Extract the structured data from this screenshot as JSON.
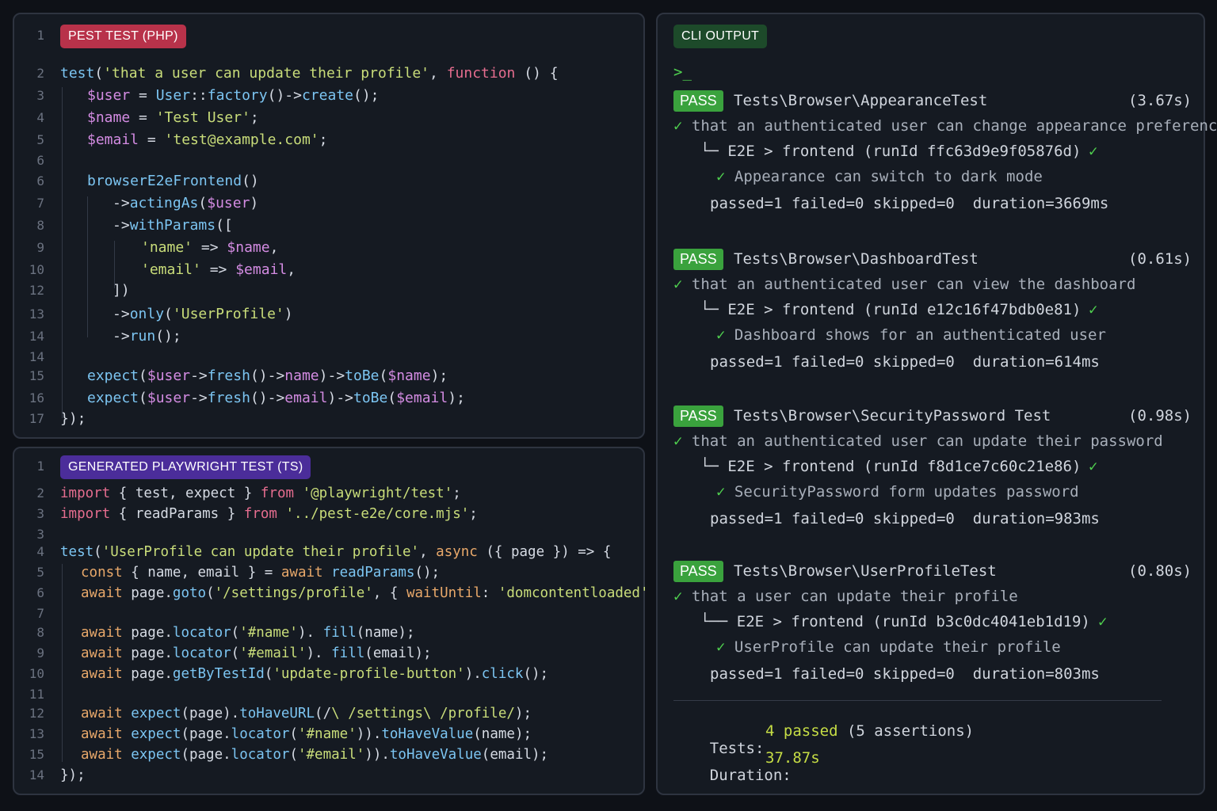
{
  "php_panel": {
    "badge": "PEST TEST (PHP)",
    "badge_color": "#b8324a",
    "lines": [
      {
        "n": "1"
      },
      {
        "n": "2"
      },
      {
        "n": "3"
      },
      {
        "n": "4"
      },
      {
        "n": "5"
      },
      {
        "n": "6"
      },
      {
        "n": "6"
      },
      {
        "n": "7"
      },
      {
        "n": "8"
      },
      {
        "n": "9"
      },
      {
        "n": "10"
      },
      {
        "n": "12"
      },
      {
        "n": "13"
      },
      {
        "n": "14"
      },
      {
        "n": "14"
      },
      {
        "n": "15"
      },
      {
        "n": "16"
      },
      {
        "n": "17"
      }
    ],
    "tokens": [
      [],
      [
        [
          "f",
          "test"
        ],
        [
          "p",
          "("
        ],
        [
          "s",
          "'that a user can update their profile'"
        ],
        [
          "p",
          ", "
        ],
        [
          "k",
          "function"
        ],
        [
          "p",
          " () {"
        ]
      ],
      [
        [
          "v",
          "$user"
        ],
        [
          "p",
          " = "
        ],
        [
          "f",
          "User"
        ],
        [
          "p",
          "::"
        ],
        [
          "f",
          "factory"
        ],
        [
          "p",
          "()->"
        ],
        [
          "f",
          "create"
        ],
        [
          "p",
          "();"
        ]
      ],
      [
        [
          "v",
          "$name"
        ],
        [
          "p",
          " = "
        ],
        [
          "s",
          "'Test User'"
        ],
        [
          "p",
          ";"
        ]
      ],
      [
        [
          "v",
          "$email"
        ],
        [
          "p",
          " = "
        ],
        [
          "s",
          "'test@example.com'"
        ],
        [
          "p",
          ";"
        ]
      ],
      [],
      [
        [
          "f",
          "browserE2eFrontend"
        ],
        [
          "p",
          "()"
        ]
      ],
      [
        [
          "p",
          "->"
        ],
        [
          "f",
          "actingAs"
        ],
        [
          "p",
          "("
        ],
        [
          "v",
          "$user"
        ],
        [
          "p",
          ")"
        ]
      ],
      [
        [
          "p",
          "->"
        ],
        [
          "f",
          "withParams"
        ],
        [
          "p",
          "(["
        ]
      ],
      [
        [
          "s",
          "'name'"
        ],
        [
          "p",
          " => "
        ],
        [
          "v",
          "$name"
        ],
        [
          "p",
          ","
        ]
      ],
      [
        [
          "s",
          "'email'"
        ],
        [
          "p",
          " => "
        ],
        [
          "v",
          "$email"
        ],
        [
          "p",
          ","
        ]
      ],
      [
        [
          "p",
          "])"
        ]
      ],
      [
        [
          "p",
          "->"
        ],
        [
          "f",
          "only"
        ],
        [
          "p",
          "("
        ],
        [
          "s",
          "'UserProfile'"
        ],
        [
          "p",
          ")"
        ]
      ],
      [
        [
          "p",
          "->"
        ],
        [
          "f",
          "run"
        ],
        [
          "p",
          "();"
        ]
      ],
      [],
      [
        [
          "f",
          "expect"
        ],
        [
          "p",
          "("
        ],
        [
          "v",
          "$user"
        ],
        [
          "p",
          "->"
        ],
        [
          "f",
          "fresh"
        ],
        [
          "p",
          "()->"
        ],
        [
          "v",
          "name"
        ],
        [
          "p",
          ")->"
        ],
        [
          "f",
          "toBe"
        ],
        [
          "p",
          "("
        ],
        [
          "v",
          "$name"
        ],
        [
          "p",
          ");"
        ]
      ],
      [
        [
          "f",
          "expect"
        ],
        [
          "p",
          "("
        ],
        [
          "v",
          "$user"
        ],
        [
          "p",
          "->"
        ],
        [
          "f",
          "fresh"
        ],
        [
          "p",
          "()->"
        ],
        [
          "v",
          "email"
        ],
        [
          "p",
          ")->"
        ],
        [
          "f",
          "toBe"
        ],
        [
          "p",
          "("
        ],
        [
          "v",
          "$email"
        ],
        [
          "p",
          ");"
        ]
      ],
      [
        [
          "p",
          "});"
        ]
      ]
    ]
  },
  "ts_panel": {
    "badge": "GENERATED PLAYWRIGHT TEST (TS)",
    "badge_color": "#4b2d9a",
    "lines": [
      {
        "n": "1"
      },
      {
        "n": "2"
      },
      {
        "n": "3"
      },
      {
        "n": "3"
      },
      {
        "n": "4"
      },
      {
        "n": "5"
      },
      {
        "n": "6"
      },
      {
        "n": "7"
      },
      {
        "n": "8"
      },
      {
        "n": "9"
      },
      {
        "n": "10"
      },
      {
        "n": "11"
      },
      {
        "n": "12"
      },
      {
        "n": "13"
      },
      {
        "n": "15"
      },
      {
        "n": "14"
      }
    ],
    "tokens": [
      [],
      [
        [
          "k",
          "import"
        ],
        [
          "p",
          " { test, expect } "
        ],
        [
          "k",
          "from"
        ],
        [
          "p",
          " "
        ],
        [
          "s",
          "'@playwright/test'"
        ],
        [
          "p",
          ";"
        ]
      ],
      [
        [
          "k",
          "import"
        ],
        [
          "p",
          " { readParams } "
        ],
        [
          "k",
          "from"
        ],
        [
          "p",
          " "
        ],
        [
          "s",
          "'../pest-e2e/core.mjs'"
        ],
        [
          "p",
          ";"
        ]
      ],
      [],
      [
        [
          "f",
          "test"
        ],
        [
          "p",
          "("
        ],
        [
          "s",
          "'UserProfile can update their profile'"
        ],
        [
          "p",
          ", "
        ],
        [
          "kt",
          "async"
        ],
        [
          "p",
          " ({ page }) => {"
        ]
      ],
      [
        [
          "kt",
          "const"
        ],
        [
          "p",
          " { name, email } = "
        ],
        [
          "kt",
          "await"
        ],
        [
          "p",
          " "
        ],
        [
          "f",
          "readParams"
        ],
        [
          "p",
          "();"
        ]
      ],
      [
        [
          "kt",
          "await"
        ],
        [
          "p",
          " page."
        ],
        [
          "f",
          "goto"
        ],
        [
          "p",
          "("
        ],
        [
          "s",
          "'/settings/profile'"
        ],
        [
          "p",
          ", { "
        ],
        [
          "kt",
          "waitUntil"
        ],
        [
          "p",
          ": "
        ],
        [
          "s",
          "'domcontentloaded'"
        ],
        [
          "p",
          " });"
        ]
      ],
      [],
      [
        [
          "kt",
          "await"
        ],
        [
          "p",
          " page."
        ],
        [
          "f",
          "locator"
        ],
        [
          "p",
          "("
        ],
        [
          "s",
          "'#name'"
        ],
        [
          "p",
          "). "
        ],
        [
          "f",
          "fill"
        ],
        [
          "p",
          "(name);"
        ]
      ],
      [
        [
          "kt",
          "await"
        ],
        [
          "p",
          " page."
        ],
        [
          "f",
          "locator"
        ],
        [
          "p",
          "("
        ],
        [
          "s",
          "'#email'"
        ],
        [
          "p",
          "). "
        ],
        [
          "f",
          "fill"
        ],
        [
          "p",
          "(email);"
        ]
      ],
      [
        [
          "kt",
          "await"
        ],
        [
          "p",
          " page."
        ],
        [
          "f",
          "getByTestId"
        ],
        [
          "p",
          "("
        ],
        [
          "s",
          "'update-profile-button'"
        ],
        [
          "p",
          ")."
        ],
        [
          "f",
          "click"
        ],
        [
          "p",
          "();"
        ]
      ],
      [],
      [
        [
          "kt",
          "await"
        ],
        [
          "p",
          " "
        ],
        [
          "f",
          "expect"
        ],
        [
          "p",
          "(page)."
        ],
        [
          "f",
          "toHaveURL"
        ],
        [
          "p",
          "(/"
        ],
        [
          "s",
          "\\ /settings\\ /profile/"
        ],
        [
          "p",
          ");"
        ]
      ],
      [
        [
          "kt",
          "await"
        ],
        [
          "p",
          " "
        ],
        [
          "f",
          "expect"
        ],
        [
          "p",
          "(page."
        ],
        [
          "f",
          "locator"
        ],
        [
          "p",
          "("
        ],
        [
          "s",
          "'#name'"
        ],
        [
          "p",
          "))."
        ],
        [
          "f",
          "toHaveValue"
        ],
        [
          "p",
          "(name);"
        ]
      ],
      [
        [
          "kt",
          "await"
        ],
        [
          "p",
          " "
        ],
        [
          "f",
          "expect"
        ],
        [
          "p",
          "(page."
        ],
        [
          "f",
          "locator"
        ],
        [
          "p",
          "("
        ],
        [
          "s",
          "'#email'"
        ],
        [
          "p",
          "))."
        ],
        [
          "f",
          "toHaveValue"
        ],
        [
          "p",
          "(email);"
        ]
      ],
      [
        [
          "p",
          "});"
        ]
      ]
    ]
  },
  "cli_panel": {
    "badge": "CLI OUTPUT",
    "badge_color": "#1d4a2a",
    "prompt": ">_",
    "pass_label": "PASS",
    "tests": [
      {
        "name": "Tests\\Browser\\AppearanceTest",
        "time": "(3.67s)",
        "desc": "✓ that an authenticated user can change appearance preference",
        "branch": "└─ E2E > frontend (runId ffc63d9e9f05876d)",
        "branch_check": "✓",
        "sub": "✓ Appearance can switch to dark mode",
        "stats": "passed=1 failed=0 skipped=0  duration=3669ms"
      },
      {
        "name": "Tests\\Browser\\DashboardTest",
        "time": "(0.61s)",
        "desc": "✓ that an authenticated user can view the dashboard",
        "branch": "└─ E2E > frontend (runId e12c16f47bdb0e81)",
        "branch_check": "✓",
        "sub": "✓ Dashboard shows for an authenticated user",
        "stats": "passed=1 failed=0 skipped=0  duration=614ms"
      },
      {
        "name": "Tests\\Browser\\SecurityPassword Test",
        "time": "(0.98s)",
        "desc": "✓ that an authenticated user can update their password",
        "branch": "└─ E2E > frontend (runId f8d1ce7c60c21e86)",
        "branch_check": "✓",
        "sub": "✓ SecurityPassword form updates password",
        "stats": "passed=1 failed=0 skipped=0  duration=983ms"
      },
      {
        "name": "Tests\\Browser\\UserProfileTest",
        "time": "(0.80s)",
        "desc": "✓ that a user can update their profile",
        "branch": "└── E2E > frontend (runId b3c0dc4041eb1d19)",
        "branch_check": "✓",
        "sub": "✓ UserProfile can update their profile",
        "stats": "passed=1 failed=0 skipped=0  duration=803ms"
      }
    ],
    "summary": {
      "tests_label": "Tests:",
      "tests_value": "4 passed",
      "tests_extra": "(5 assertions)",
      "duration_label": "Duration:",
      "duration_value": "37.87s"
    },
    "colors": {
      "pass_bg": "#3aa23d",
      "check": "#4fcf4f",
      "summary_value": "#c6dd45"
    }
  }
}
